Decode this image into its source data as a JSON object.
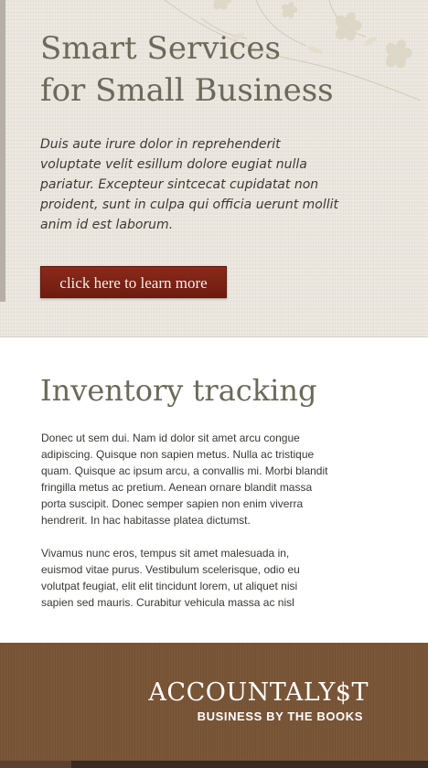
{
  "hero": {
    "title_line1": "Smart Services",
    "title_line2": "for Small Business",
    "text": "Duis aute irure dolor in reprehenderit voluptate velit esillum dolore eugiat nulla pariatur. Excepteur sintcecat cupidatat non proident, sunt in culpa qui officia uerunt mollit anim id est laborum.",
    "cta_label": "click here to learn more",
    "cta_color": "#7d2416",
    "decoration": "floral-icon"
  },
  "content": {
    "heading": "Inventory tracking",
    "paragraph1": "Donec ut sem dui. Nam id dolor sit amet arcu congue adipiscing. Quisque non sapien metus. Nulla ac tristique quam. Quisque ac ipsum arcu, a convallis mi. Morbi blandit fringilla metus ac pretium. Aenean ornare blandit massa porta suscipit. Donec semper sapien non enim viverra hendrerit. In hac habitasse platea dictumst.",
    "paragraph2": "Vivamus nunc eros, tempus sit amet malesuada in, euismod vitae purus. Vestibulum scelerisque, odio eu volutpat feugiat, elit elit tincidunt lorem, ut aliquet nisi sapien sed mauris. Curabitur vehicula massa ac nisl"
  },
  "footer": {
    "logo_name": "ACCOUNTALY$T",
    "tagline": "BUSINESS BY THE BOOKS",
    "background_color": "#7a5638"
  }
}
